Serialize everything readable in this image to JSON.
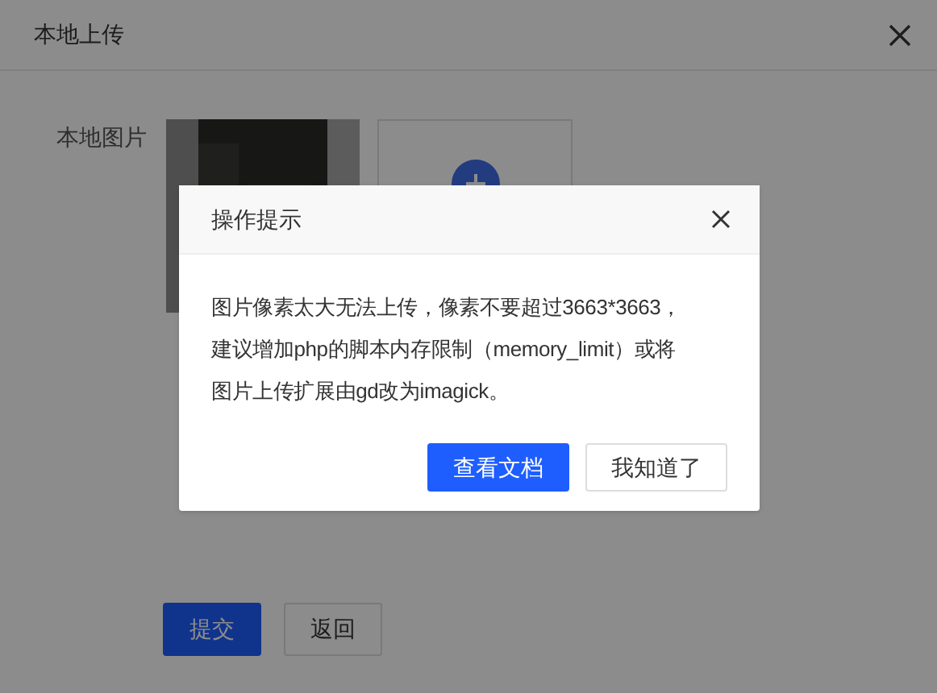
{
  "window": {
    "title": "本地上传"
  },
  "form": {
    "label": "本地图片",
    "buttons": [
      {
        "label": "提交",
        "kind": "primary"
      },
      {
        "label": "返回",
        "kind": "default"
      }
    ]
  },
  "modal": {
    "title": "操作提示",
    "message_lines": [
      "图片像素太大无法上传，像素不要超过3663*3663，",
      "建议增加php的脚本内存限制（memory_limit）或将",
      "图片上传扩展由gd改为imagick。"
    ],
    "buttons": [
      {
        "label": "查看文档",
        "kind": "primary"
      },
      {
        "label": "我知道了",
        "kind": "default"
      }
    ]
  }
}
